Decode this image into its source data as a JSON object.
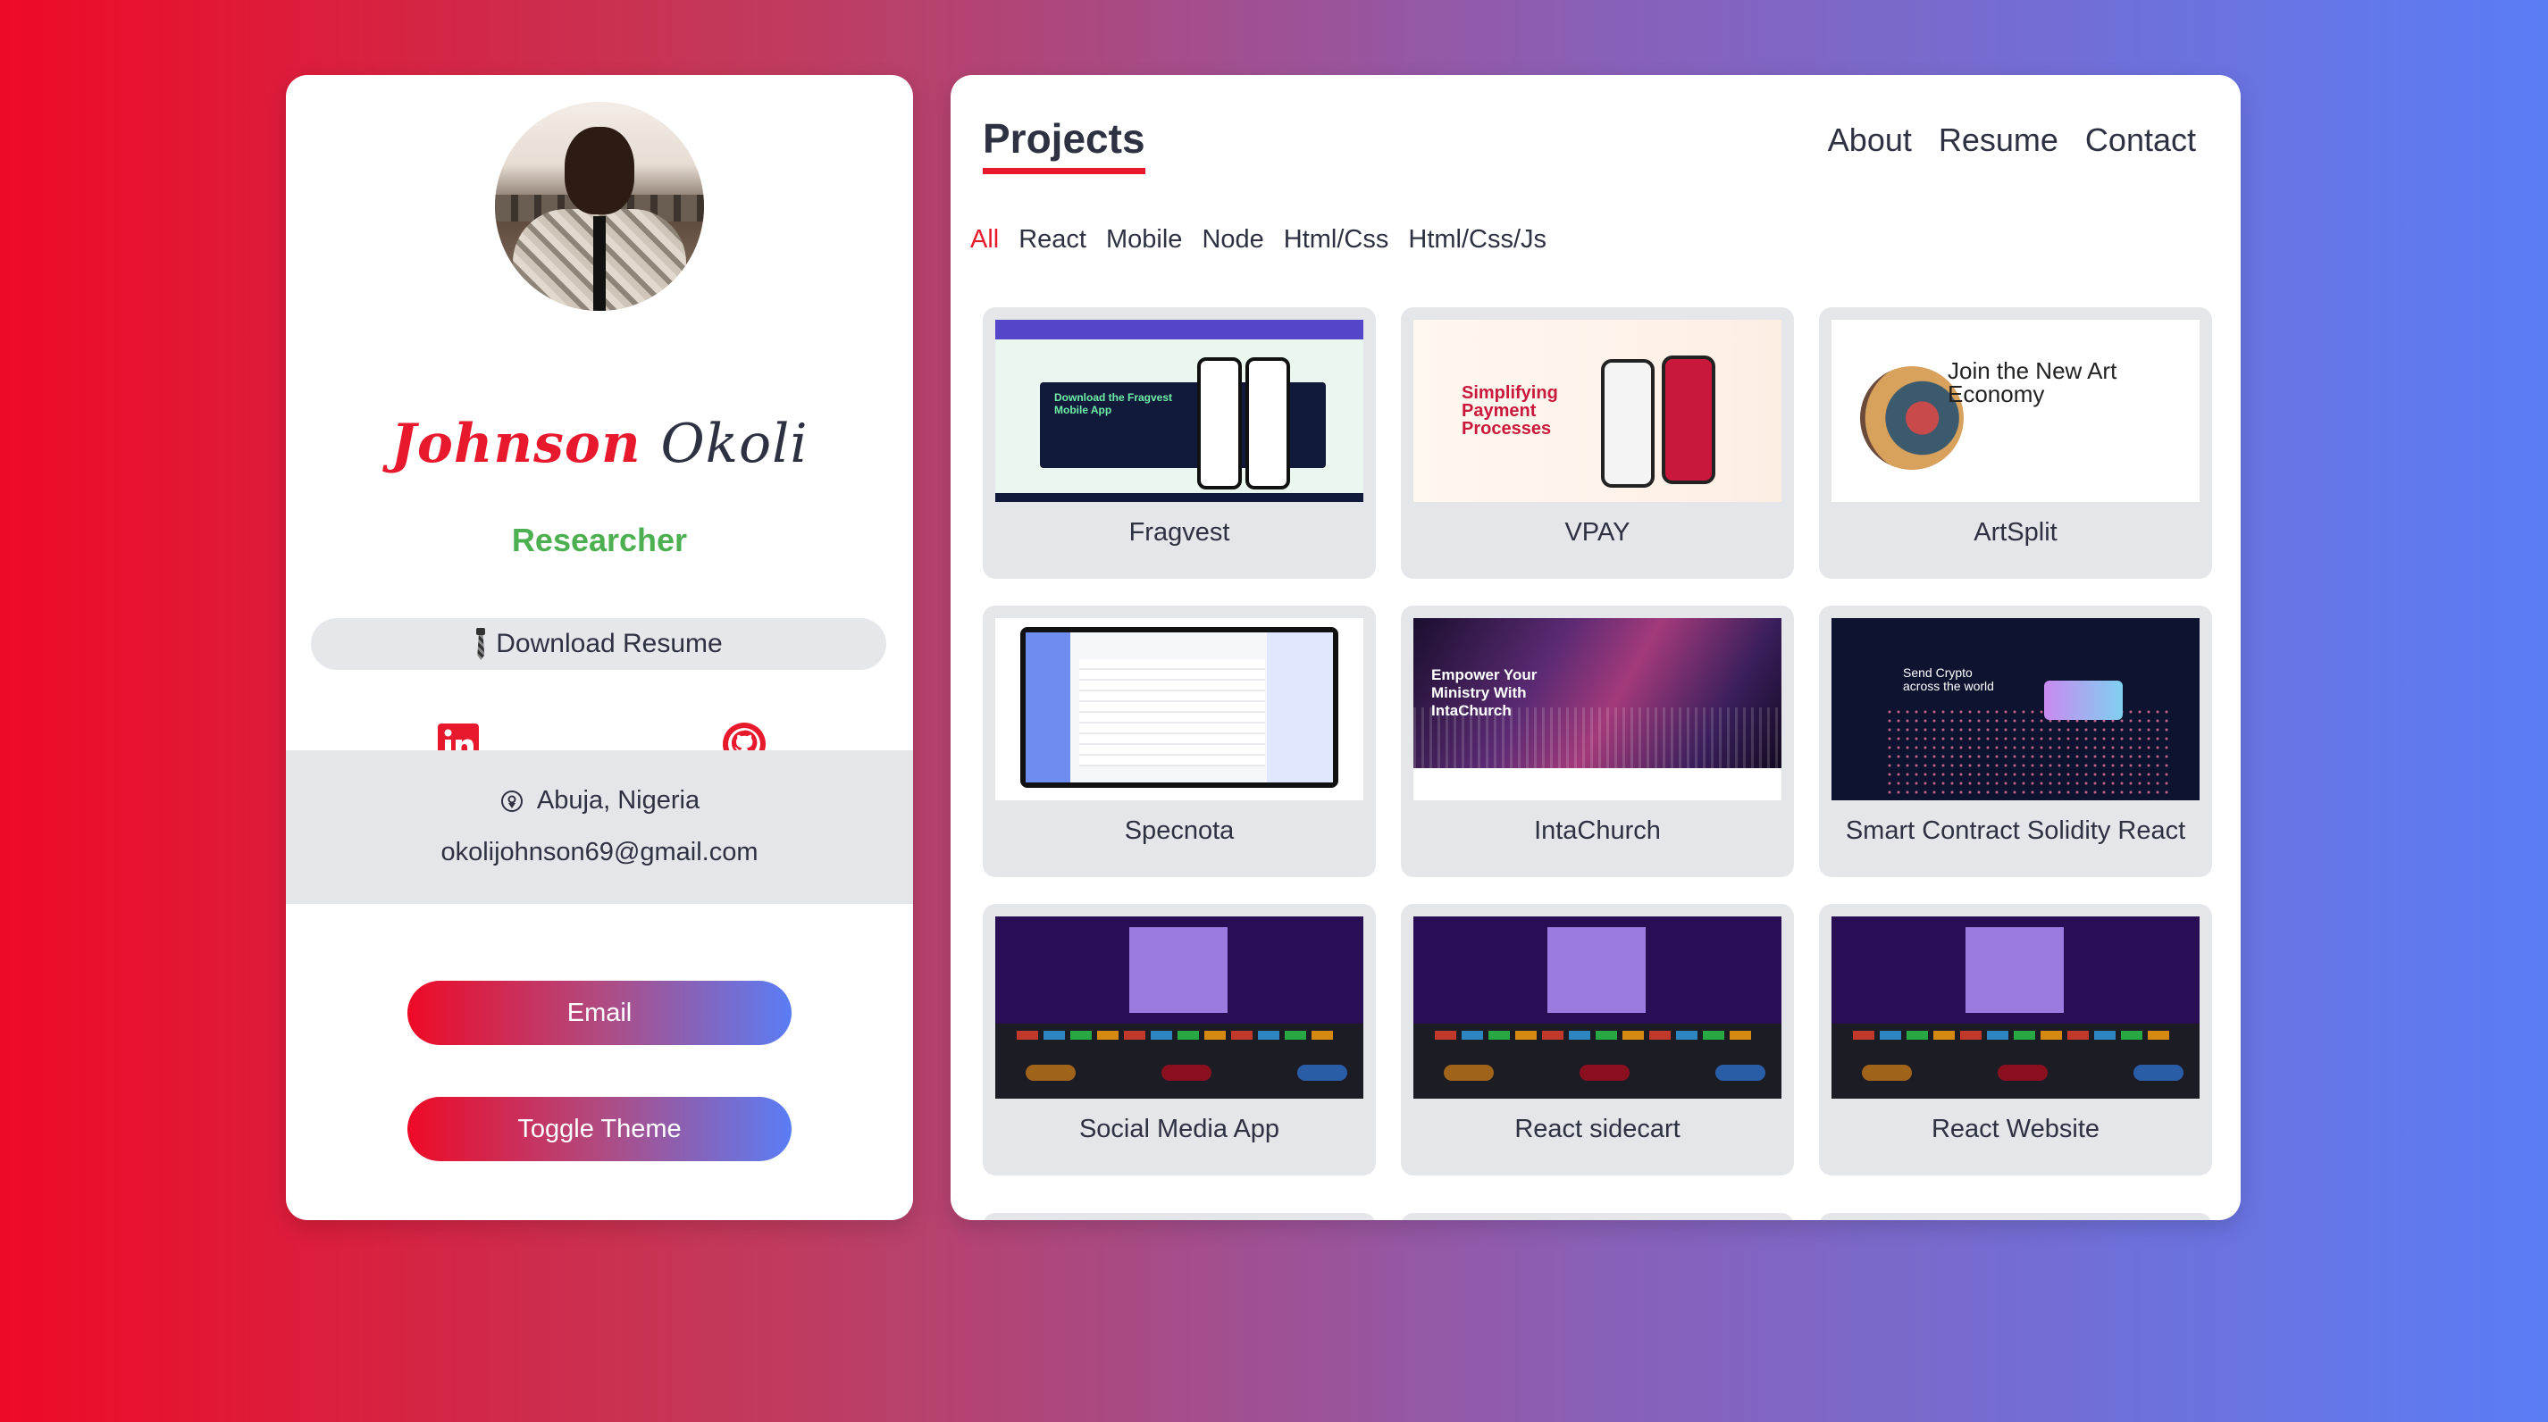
{
  "profile": {
    "first_name": "Johnson",
    "last_name": "Okoli",
    "role": "Researcher",
    "download_label": "Download Resume",
    "location": "Abuja, Nigeria",
    "email": "okolijohnson69@gmail.com",
    "buttons": {
      "email": "Email",
      "toggle_theme": "Toggle Theme"
    },
    "icons": {
      "download": "tie-icon",
      "linkedin": "linkedin-icon",
      "github": "github-icon",
      "location": "location-pin-icon"
    }
  },
  "projects": {
    "title": "Projects",
    "nav": [
      "About",
      "Resume",
      "Contact"
    ],
    "filters": [
      "All",
      "React",
      "Mobile",
      "Node",
      "Html/Css",
      "Html/Css/Js"
    ],
    "active_filter": "All",
    "items": [
      {
        "label": "Fragvest",
        "thumb_text": "Download the Fragvest Mobile App"
      },
      {
        "label": "VPAY",
        "thumb_text": "Simplifying Payment Processes"
      },
      {
        "label": "ArtSplit",
        "thumb_text": "Join the New Art Economy"
      },
      {
        "label": "Specnota"
      },
      {
        "label": "IntaChurch",
        "thumb_text": "Empower Your Ministry With IntaChurch"
      },
      {
        "label": "Smart Contract Solidity React",
        "thumb_text": "Send Crypto across the world"
      },
      {
        "label": "Social Media App"
      },
      {
        "label": "React sidecart"
      },
      {
        "label": "React Website"
      }
    ]
  },
  "colors": {
    "accent_red": "#e8192c",
    "accent_green": "#4caf50",
    "gradient_start": "#ee0a26",
    "gradient_end": "#5a7df5"
  }
}
